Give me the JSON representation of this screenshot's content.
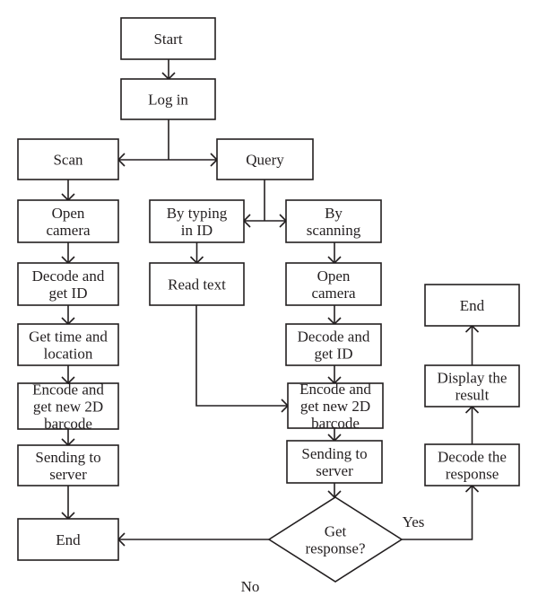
{
  "diagram": {
    "type": "flowchart",
    "nodes": {
      "start": {
        "lines": [
          "Start"
        ],
        "shape": "process"
      },
      "login": {
        "lines": [
          "Log in"
        ],
        "shape": "process"
      },
      "scan": {
        "lines": [
          "Scan"
        ],
        "shape": "process"
      },
      "query": {
        "lines": [
          "Query"
        ],
        "shape": "process"
      },
      "scan_open_camera": {
        "lines": [
          "Open",
          "camera"
        ],
        "shape": "process"
      },
      "scan_decode": {
        "lines": [
          "Decode and",
          "get ID"
        ],
        "shape": "process"
      },
      "scan_get_time": {
        "lines": [
          "Get time and",
          "location"
        ],
        "shape": "process"
      },
      "scan_encode": {
        "lines": [
          "Encode and",
          "get new 2D",
          "barcode"
        ],
        "shape": "process"
      },
      "scan_send": {
        "lines": [
          "Sending to",
          "server"
        ],
        "shape": "process"
      },
      "scan_end": {
        "lines": [
          "End"
        ],
        "shape": "process"
      },
      "by_typing": {
        "lines": [
          "By typing",
          "in ID"
        ],
        "shape": "process"
      },
      "read_text": {
        "lines": [
          "Read text"
        ],
        "shape": "process"
      },
      "by_scanning": {
        "lines": [
          "By",
          "scanning"
        ],
        "shape": "process"
      },
      "query_open_camera": {
        "lines": [
          "Open",
          "camera"
        ],
        "shape": "process"
      },
      "query_decode": {
        "lines": [
          "Decode and",
          "get ID"
        ],
        "shape": "process"
      },
      "query_encode": {
        "lines": [
          "Encode and",
          "get new 2D",
          "barcode"
        ],
        "shape": "process"
      },
      "query_send": {
        "lines": [
          "Sending to",
          "server"
        ],
        "shape": "process"
      },
      "get_response": {
        "lines": [
          "Get",
          "response?"
        ],
        "shape": "decision"
      },
      "decode_response": {
        "lines": [
          "Decode the",
          "response"
        ],
        "shape": "process"
      },
      "display_result": {
        "lines": [
          "Display the",
          "result"
        ],
        "shape": "process"
      },
      "query_end": {
        "lines": [
          "End"
        ],
        "shape": "process"
      }
    },
    "edges": [
      {
        "from": "start",
        "to": "login"
      },
      {
        "from": "login",
        "to": "scan"
      },
      {
        "from": "login",
        "to": "query"
      },
      {
        "from": "scan",
        "to": "scan_open_camera"
      },
      {
        "from": "scan_open_camera",
        "to": "scan_decode"
      },
      {
        "from": "scan_decode",
        "to": "scan_get_time"
      },
      {
        "from": "scan_get_time",
        "to": "scan_encode"
      },
      {
        "from": "scan_encode",
        "to": "scan_send"
      },
      {
        "from": "scan_send",
        "to": "scan_end"
      },
      {
        "from": "query",
        "to": "by_typing"
      },
      {
        "from": "query",
        "to": "by_scanning"
      },
      {
        "from": "by_typing",
        "to": "read_text"
      },
      {
        "from": "read_text",
        "to": "query_encode"
      },
      {
        "from": "by_scanning",
        "to": "query_open_camera"
      },
      {
        "from": "query_open_camera",
        "to": "query_decode"
      },
      {
        "from": "query_decode",
        "to": "query_encode"
      },
      {
        "from": "query_encode",
        "to": "query_send"
      },
      {
        "from": "query_send",
        "to": "get_response"
      },
      {
        "from": "get_response",
        "to": "scan_end",
        "label": "No"
      },
      {
        "from": "get_response",
        "to": "decode_response",
        "label": "Yes"
      },
      {
        "from": "decode_response",
        "to": "display_result"
      },
      {
        "from": "display_result",
        "to": "query_end"
      }
    ],
    "edge_labels": {
      "no": "No",
      "yes": "Yes"
    }
  }
}
